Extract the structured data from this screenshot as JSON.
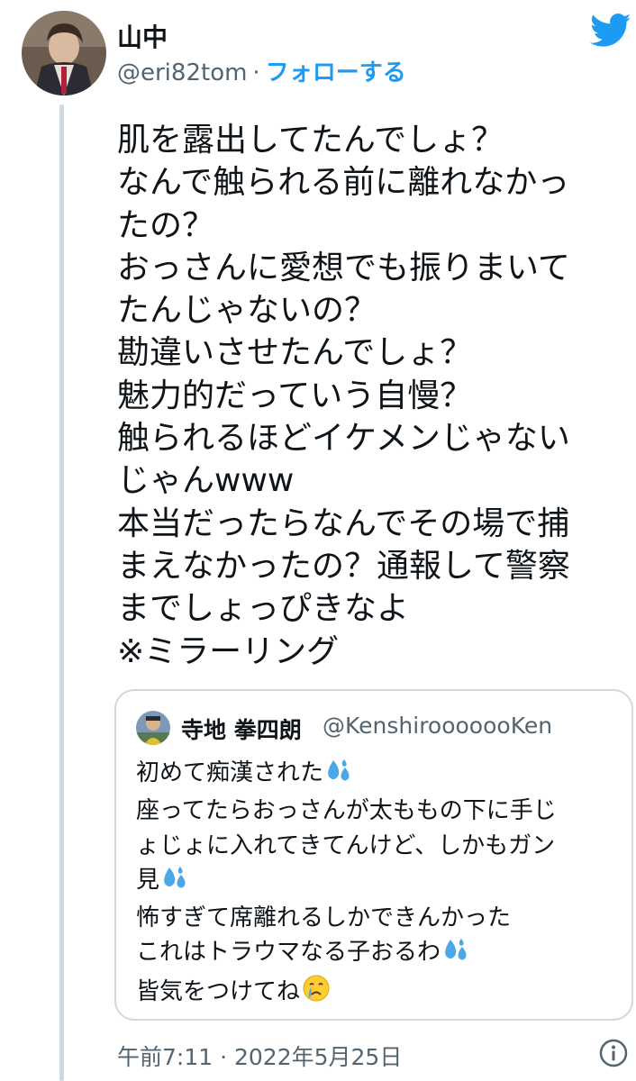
{
  "author": {
    "display_name": "山中",
    "handle": "@eri82tom",
    "separator": "·",
    "follow_label": "フォローする"
  },
  "brand_icon": "twitter-bird-icon",
  "tweet_lines": [
    "肌を露出してたんでしょ？",
    "なんで触られる前に離れなかっ",
    "たの？",
    "おっさんに愛想でも振りまいて",
    "たんじゃないの？",
    "勘違いさせたんでしょ？",
    "魅力的だっていう自慢？",
    "触られるほどイケメンじゃない",
    "じゃんwww",
    "本当だったらなんでその場で捕",
    "まえなかったの？通報して警察",
    "までしょっぴきなよ",
    "※ミラーリング"
  ],
  "quoted_tweet": {
    "display_name": "寺地 拳四朗",
    "handle": "@KenshirooooooKen",
    "lines": [
      "初めて痴漢された",
      "座ってたらおっさんが太ももの下に手じ",
      "ょじょに入れてきてんけど、しかもガン",
      "見",
      "怖すぎて席離れるしかできんかった",
      "これはトラウマなる子おるわ",
      "皆気をつけてね"
    ]
  },
  "timestamp": "午前7:11 · 2022年5月25日",
  "colors": {
    "accent": "#1d9bf0",
    "text": "#0f1419",
    "secondary": "#536471",
    "border": "#cfd9de"
  }
}
